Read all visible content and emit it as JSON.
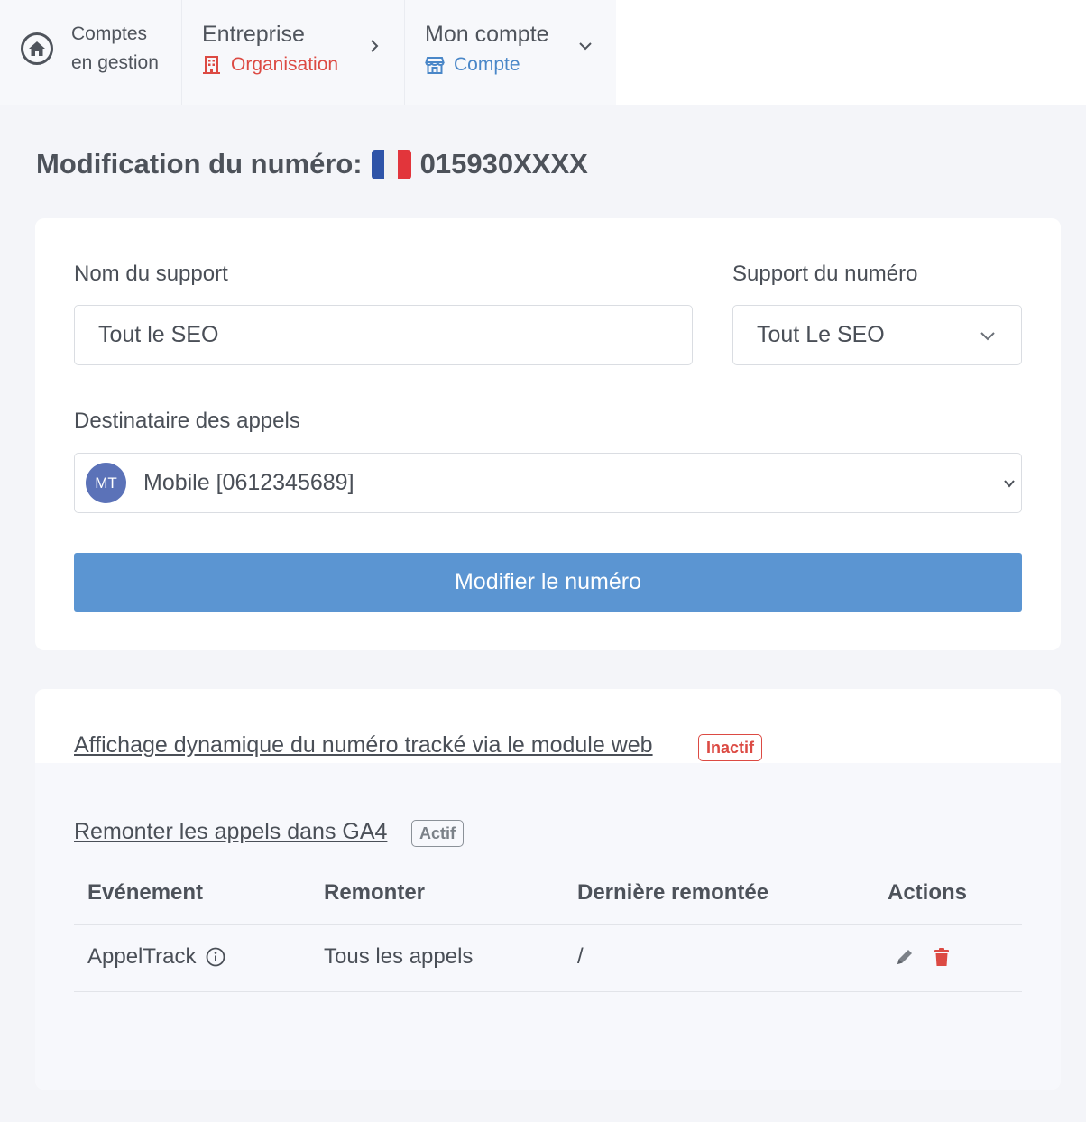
{
  "breadcrumb": {
    "home": {
      "line1": "Comptes",
      "line2": "en gestion",
      "icon": "home-icon"
    },
    "entreprise": {
      "title": "Entreprise",
      "sub": "Organisation",
      "sub_color": "#dc4a43",
      "icon": "building-icon"
    },
    "account": {
      "title": "Mon compte",
      "sub": "Compte",
      "sub_color": "#4a87c8",
      "icon": "store-icon"
    }
  },
  "page": {
    "title_prefix": "Modification du numéro:",
    "number": "015930XXXX",
    "flag": "fr-flag-icon"
  },
  "form": {
    "support_name_label": "Nom du support",
    "support_name_value": "Tout le SEO",
    "support_select_label": "Support du numéro",
    "support_select_value": "Tout Le SEO",
    "recipient_label": "Destinataire des appels",
    "recipient_avatar": "MT",
    "recipient_value": "Mobile [0612345689]",
    "submit_label": "Modifier le numéro",
    "accent_color": "#5b95d2"
  },
  "tracking": {
    "dynamic_link": "Affichage dynamique du numéro tracké via le module web",
    "dynamic_status": "Inactif",
    "ga4_link": "Remonter les appels dans GA4",
    "ga4_status": "Actif",
    "columns": [
      "Evénement",
      "Remonter",
      "Dernière remontée",
      "Actions"
    ],
    "rows": [
      {
        "event": "AppelTrack",
        "scope": "Tous les appels",
        "last": "/"
      }
    ]
  }
}
